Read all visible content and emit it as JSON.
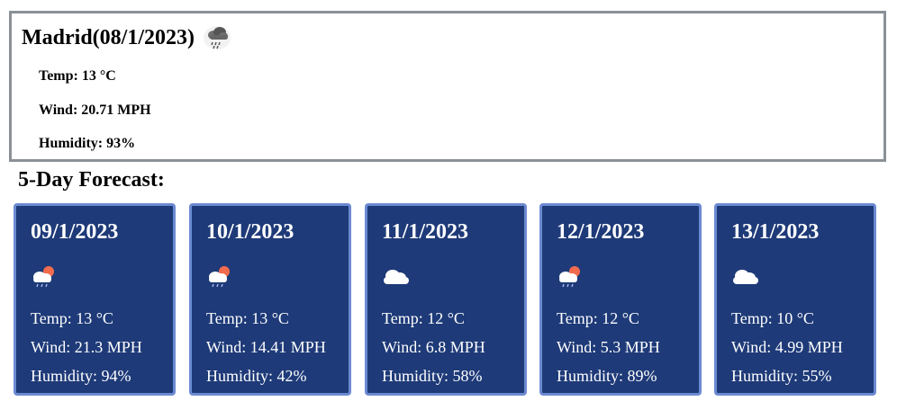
{
  "current": {
    "title": "Madrid(08/1/2023)",
    "icon": "rain-cloud-icon",
    "temp": "Temp: 13 °C",
    "wind": "Wind: 20.71 MPH",
    "humidity": "Humidity: 93%"
  },
  "forecast": {
    "heading": "5-Day Forecast:",
    "days": [
      {
        "date": "09/1/2023",
        "icon": "sun-rain-cloud-icon",
        "temp": "Temp: 13 °C",
        "wind": "Wind: 21.3 MPH",
        "humidity": "Humidity: 94%"
      },
      {
        "date": "10/1/2023",
        "icon": "sun-rain-cloud-icon",
        "temp": "Temp: 13 °C",
        "wind": "Wind: 14.41 MPH",
        "humidity": "Humidity: 42%"
      },
      {
        "date": "11/1/2023",
        "icon": "cloud-icon",
        "temp": "Temp: 12 °C",
        "wind": "Wind: 6.8 MPH",
        "humidity": "Humidity: 58%"
      },
      {
        "date": "12/1/2023",
        "icon": "sun-rain-cloud-icon",
        "temp": "Temp: 12 °C",
        "wind": "Wind: 5.3 MPH",
        "humidity": "Humidity: 89%"
      },
      {
        "date": "13/1/2023",
        "icon": "cloud-icon",
        "temp": "Temp: 10 °C",
        "wind": "Wind: 4.99 MPH",
        "humidity": "Humidity: 55%"
      }
    ]
  },
  "colors": {
    "card_bg": "#1e3a78",
    "card_border": "#6c8ad1",
    "current_border": "#8a9096"
  }
}
